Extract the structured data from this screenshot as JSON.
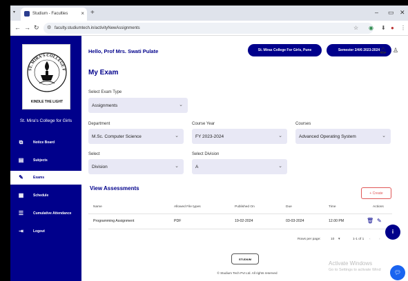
{
  "browser": {
    "tab_title": "Studium - Faculties",
    "tab_close": "×",
    "new_tab": "+",
    "tab_menu": "▾",
    "minimize": "–",
    "restore": "▭",
    "close": "✕",
    "url": "faculty.studiumtech.in/activityNewAssignments"
  },
  "sidebar": {
    "logo_motto": "KINDLE THE LIGHT",
    "logo_ring_text": "ST. MIRA'S COLLEGE FOR GIRLS",
    "college_name": "St. Mira's College for Girls",
    "items": [
      {
        "label": "Notice Board",
        "icon": "notice-icon"
      },
      {
        "label": "Subjects",
        "icon": "book-icon"
      },
      {
        "label": "Exams",
        "icon": "pencil-icon"
      },
      {
        "label": "Schedule",
        "icon": "calendar-icon"
      },
      {
        "label": "Cumulative Attendance",
        "icon": "list-icon"
      },
      {
        "label": "Logout",
        "icon": "logout-icon"
      }
    ]
  },
  "header": {
    "greeting": "Hello, Prof Mrs. Swati Pulate",
    "college_pill": "St. Miras College For Girls, Pune",
    "semester_pill": "Semester 2/4/6 2023-2024"
  },
  "page": {
    "title": "My Exam",
    "exam_type_label": "Select Exam Type",
    "exam_type_value": "Assignments",
    "department_label": "Department",
    "department_value": "M.Sc. Computer Science",
    "course_year_label": "Course Year",
    "course_year_value": "FY 2023-2024",
    "courses_label": "Courses",
    "courses_value": "Advanced Operating System",
    "select_label": "Select",
    "select_value": "Division",
    "division_label": "Select Division",
    "division_value": "A"
  },
  "assessments": {
    "title": "View Assessments",
    "create_label": "+ Create",
    "columns": [
      "Name",
      "Allowed File types",
      "Published On",
      "Due",
      "Time",
      "Actions"
    ],
    "rows": [
      {
        "name": "Programming Assignment",
        "file_types": "PDF",
        "published": "19-02-2024",
        "due": "03-03-2024",
        "time": "12.00 PM"
      }
    ],
    "rows_per_page_label": "Rows per page:",
    "rows_per_page_value": "10",
    "range": "1-1 of 1"
  },
  "footer": {
    "logo_text": "STUDIUM",
    "copyright": "© Studium Tech Pvt Ltd. All rights reserved"
  },
  "watermark": {
    "line1": "Activate Windows",
    "line2": "Go to Settings to activate Wind"
  },
  "colors": {
    "brand": "#00008b",
    "create": "#e05555",
    "chat": "#1a64f0"
  }
}
